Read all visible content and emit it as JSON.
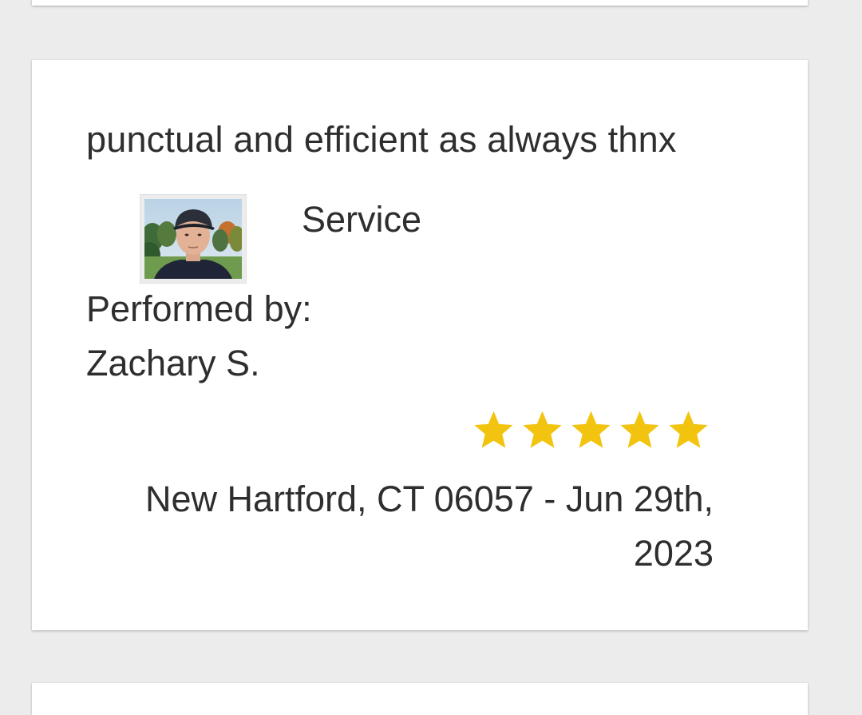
{
  "review": {
    "comment": "punctual and efficient as always thnx",
    "service_label": "Service",
    "performed_by_label": "Performed by:",
    "technician_name": "Zachary S.",
    "rating": 5,
    "rating_max": 5,
    "location_date": "New Hartford, CT 06057 - Jun 29th, 2023",
    "star_color": "#f2c40f",
    "avatar_icon": "technician-photo"
  },
  "colors": {
    "page_background": "#ececec",
    "card_background": "#ffffff",
    "text": "#2e2e2e",
    "star": "#f2c40f"
  }
}
